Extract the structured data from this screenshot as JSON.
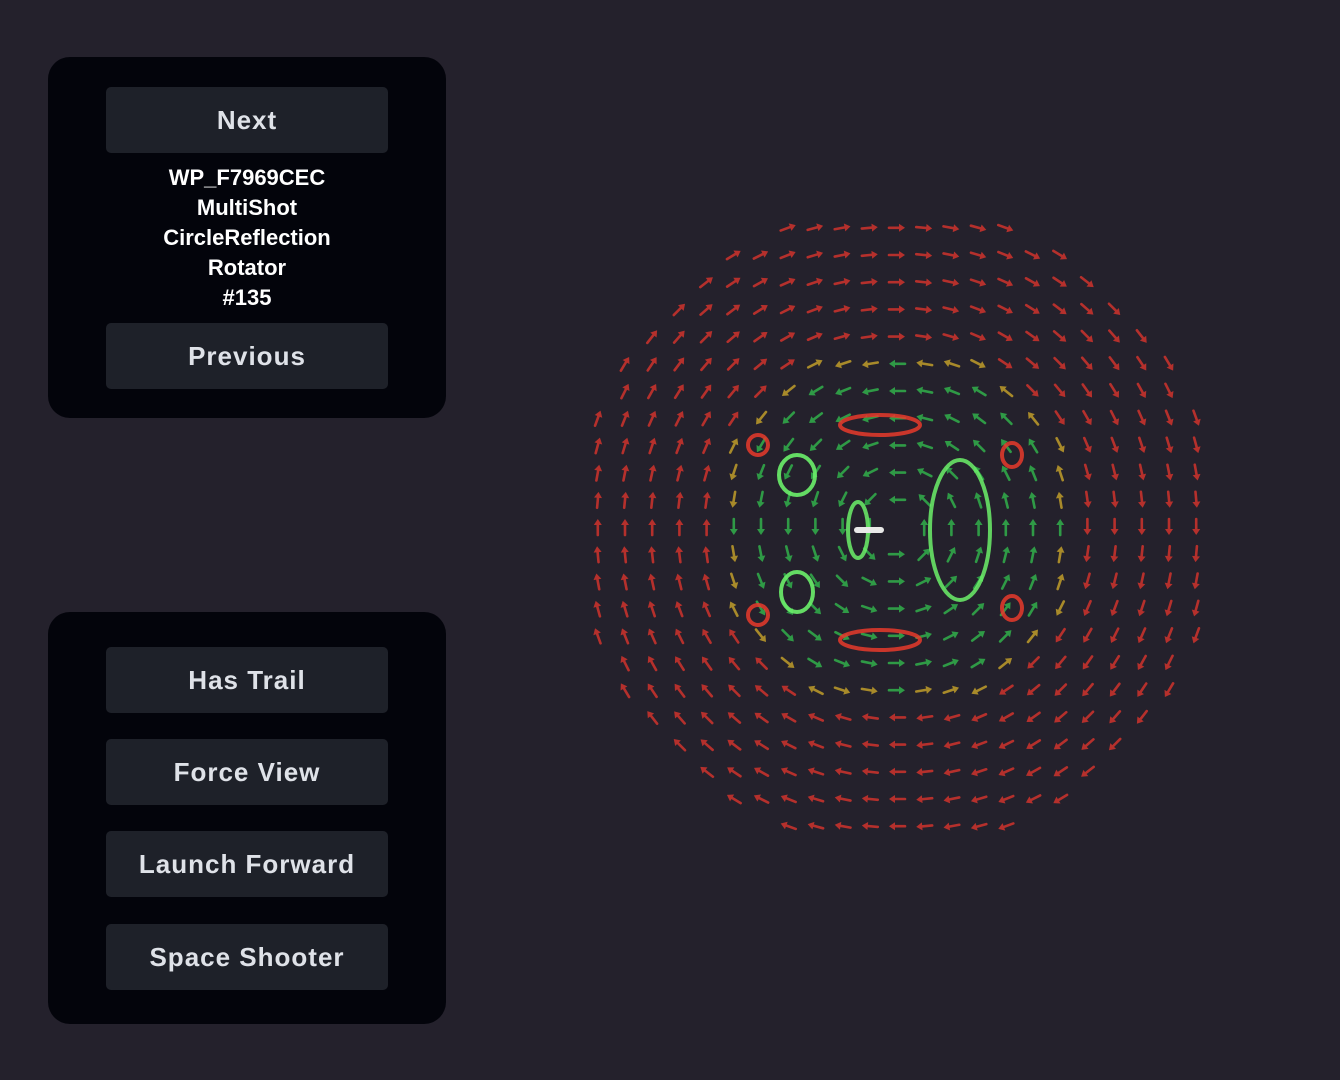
{
  "nav": {
    "next_label": "Next",
    "previous_label": "Previous"
  },
  "pattern": {
    "id": "WP_F7969CEC",
    "shot_type": "MultiShot",
    "reflection": "CircleReflection",
    "modifier": "Rotator",
    "index": "#135"
  },
  "options": {
    "has_trail_label": "Has Trail",
    "force_view_label": "Force View",
    "launch_forward_label": "Launch Forward",
    "space_shooter_label": "Space Shooter"
  },
  "force_field": {
    "outer_color": "#b5302c",
    "inner_color": "#2f9a46",
    "transition_color": "#a88a2a",
    "projectile_color": "#6cf06a",
    "reflection_color": "#e83a2c",
    "core_color": "#e8e8e8"
  }
}
